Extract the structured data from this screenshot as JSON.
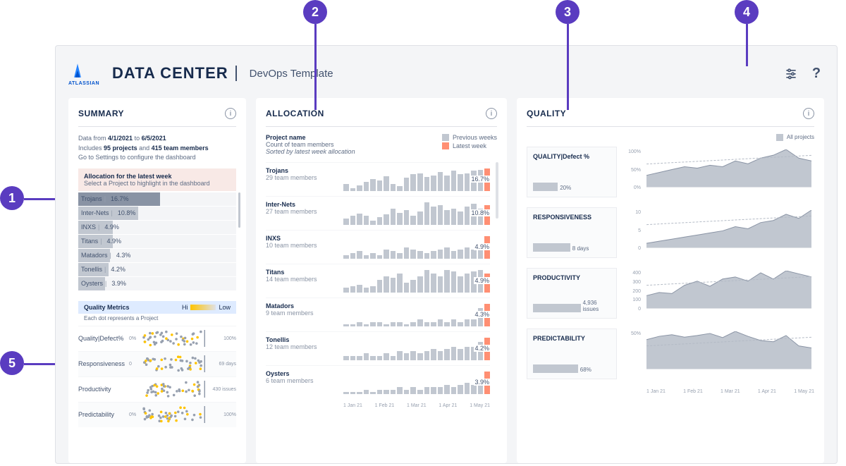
{
  "annotations": [
    "1",
    "2",
    "3",
    "4",
    "5"
  ],
  "header": {
    "logo_text": "ATLASSIAN",
    "title": "DATA CENTER",
    "subtitle": "DevOps Template"
  },
  "summary": {
    "title": "SUMMARY",
    "date_from": "4/1/2021",
    "date_to": "6/5/2021",
    "projects_count": "95 projects",
    "members_count": "415 team members",
    "data_from_label": "Data from",
    "to_label": "to",
    "includes_label": "Includes",
    "and_label": "and",
    "config_line": "Go to Settings to configure the dashboard",
    "alloc_box_title": "Allocation for the latest week",
    "alloc_box_sub": "Select a Project to highlight in the dashboard",
    "projects": [
      {
        "name": "Trojans",
        "pct": "16.7%",
        "bar": 52,
        "selected": true
      },
      {
        "name": "Inter-Nets",
        "pct": "10.8%",
        "bar": 38,
        "selected": false
      },
      {
        "name": "INXS",
        "pct": "4.9%",
        "bar": 22,
        "selected": false
      },
      {
        "name": "Titans",
        "pct": "4.9%",
        "bar": 22,
        "selected": false
      },
      {
        "name": "Matadors",
        "pct": "4.3%",
        "bar": 20,
        "selected": false
      },
      {
        "name": "Tonellis",
        "pct": "4.2%",
        "bar": 19,
        "selected": false
      },
      {
        "name": "Oysters",
        "pct": "3.9%",
        "bar": 17,
        "selected": false
      }
    ],
    "qm": {
      "title": "Quality Metrics",
      "sub": "Each dot represents a Project",
      "hi": "Hi",
      "low": "Low",
      "rows": [
        {
          "label": "Quality|Defect%",
          "axis_l": "0%",
          "axis_r": "100%"
        },
        {
          "label": "Responsiveness",
          "axis_l": "0",
          "axis_r": "69 days"
        },
        {
          "label": "Productivity",
          "axis_l": "",
          "axis_r": "430 issues"
        },
        {
          "label": "Predictability",
          "axis_l": "0%",
          "axis_r": "100%"
        }
      ]
    }
  },
  "allocation": {
    "title": "ALLOCATION",
    "col_title": "Project name",
    "col_sub": "Count of team members",
    "col_sort": "Sorted by latest week allocation",
    "legend_prev": "Previous weeks",
    "legend_latest": "Latest week",
    "xaxis": [
      "1 Jan 21",
      "1 Feb 21",
      "1 Mar 21",
      "1 Apr 21",
      "1 May 21"
    ],
    "rows": [
      {
        "name": "Trojans",
        "members": "29 team members",
        "pct": "16.7%",
        "bars": [
          12,
          5,
          10,
          15,
          20,
          18,
          25,
          12,
          8,
          22,
          28,
          30,
          24,
          26,
          32,
          26,
          35,
          28,
          30,
          34,
          36,
          38
        ]
      },
      {
        "name": "Inter-Nets",
        "members": "27 team members",
        "pct": "10.8%",
        "bars": [
          8,
          12,
          15,
          12,
          6,
          10,
          14,
          22,
          16,
          20,
          12,
          18,
          30,
          24,
          26,
          20,
          22,
          18,
          24,
          28,
          22,
          26
        ]
      },
      {
        "name": "INXS",
        "members": "10 team members",
        "pct": "4.9%",
        "bars": [
          2,
          3,
          4,
          2,
          3,
          2,
          5,
          4,
          3,
          6,
          5,
          4,
          3,
          4,
          5,
          6,
          4,
          5,
          6,
          5,
          6,
          12
        ]
      },
      {
        "name": "Titans",
        "members": "14 team members",
        "pct": "4.9%",
        "bars": [
          3,
          4,
          5,
          3,
          4,
          8,
          10,
          9,
          12,
          6,
          8,
          10,
          14,
          12,
          10,
          14,
          13,
          10,
          12,
          13,
          14,
          12
        ]
      },
      {
        "name": "Matadors",
        "members": "9 team members",
        "pct": "4.3%",
        "bars": [
          1,
          1,
          2,
          1,
          2,
          2,
          1,
          2,
          2,
          1,
          2,
          3,
          2,
          2,
          3,
          2,
          3,
          2,
          3,
          3,
          8,
          10
        ]
      },
      {
        "name": "Tonellis",
        "members": "12 team members",
        "pct": "4.2%",
        "bars": [
          2,
          2,
          2,
          3,
          2,
          2,
          3,
          2,
          4,
          3,
          4,
          3,
          4,
          5,
          4,
          5,
          6,
          5,
          6,
          6,
          8,
          10
        ]
      },
      {
        "name": "Oysters",
        "members": "6 team members",
        "pct": "3.9%",
        "bars": [
          1,
          1,
          1,
          2,
          1,
          2,
          2,
          2,
          3,
          2,
          3,
          2,
          3,
          3,
          3,
          4,
          3,
          4,
          5,
          4,
          6,
          10
        ]
      }
    ]
  },
  "quality": {
    "title": "QUALITY",
    "legend": "All projects",
    "xaxis": [
      "1 Jan 21",
      "1 Feb 21",
      "1 Mar 21",
      "1 Apr 21",
      "1 May 21"
    ],
    "cards": [
      {
        "name": "QUALITY|Defect %",
        "value": "20%",
        "bar": 32,
        "yticks": [
          "100%",
          "50%",
          "0%"
        ],
        "series": [
          8,
          10,
          12,
          14,
          13,
          15,
          14,
          18,
          16,
          20,
          22,
          26,
          20,
          18
        ]
      },
      {
        "name": "RESPONSIVENESS",
        "value": "8 days",
        "bar": 48,
        "yticks": [
          "10",
          "5",
          "0"
        ],
        "series": [
          1,
          1.5,
          2,
          2.5,
          3,
          3.5,
          4,
          5,
          4.5,
          6,
          6.5,
          8,
          7,
          9
        ]
      },
      {
        "name": "PRODUCTIVITY",
        "value": "4,936 issues",
        "bar": 70,
        "yticks": [
          "400",
          "300",
          "200",
          "100",
          "0"
        ],
        "series": [
          120,
          150,
          140,
          220,
          260,
          210,
          280,
          300,
          260,
          340,
          280,
          360,
          330,
          300
        ]
      },
      {
        "name": "PREDICTABILITY",
        "value": "68%",
        "bar": 58,
        "yticks": [
          "50%",
          ""
        ],
        "series": [
          70,
          78,
          82,
          76,
          80,
          85,
          75,
          90,
          78,
          68,
          65,
          80,
          55,
          50
        ]
      }
    ]
  },
  "chart_data": {
    "allocation_bars": {
      "type": "bar",
      "note": "Weekly allocation per project; latest bar highlighted",
      "x": "weeks Jan-May 2021",
      "series_identical_to": "allocation.rows[].bars"
    },
    "quality_trends": [
      {
        "name": "QUALITY|Defect %",
        "type": "area",
        "ylim": [
          0,
          100
        ],
        "unit": "%",
        "x": [
          "1 Jan 21",
          "1 Feb 21",
          "1 Mar 21",
          "1 Apr 21",
          "1 May 21"
        ],
        "values": [
          8,
          10,
          12,
          14,
          13,
          15,
          14,
          18,
          16,
          20,
          22,
          26,
          20,
          18
        ]
      },
      {
        "name": "RESPONSIVENESS",
        "type": "area",
        "ylim": [
          0,
          10
        ],
        "unit": "days",
        "x": [
          "1 Jan 21",
          "1 Feb 21",
          "1 Mar 21",
          "1 Apr 21",
          "1 May 21"
        ],
        "values": [
          1,
          1.5,
          2,
          2.5,
          3,
          3.5,
          4,
          5,
          4.5,
          6,
          6.5,
          8,
          7,
          9
        ]
      },
      {
        "name": "PRODUCTIVITY",
        "type": "area",
        "ylim": [
          0,
          400
        ],
        "unit": "issues",
        "x": [
          "1 Jan 21",
          "1 Feb 21",
          "1 Mar 21",
          "1 Apr 21",
          "1 May 21"
        ],
        "values": [
          120,
          150,
          140,
          220,
          260,
          210,
          280,
          300,
          260,
          340,
          280,
          360,
          330,
          300
        ]
      },
      {
        "name": "PREDICTABILITY",
        "type": "area",
        "ylim": [
          0,
          100
        ],
        "unit": "%",
        "x": [
          "1 Jan 21",
          "1 Feb 21",
          "1 Mar 21",
          "1 Apr 21",
          "1 May 21"
        ],
        "values": [
          70,
          78,
          82,
          76,
          80,
          85,
          75,
          90,
          78,
          68,
          65,
          80,
          55,
          50
        ]
      }
    ]
  }
}
